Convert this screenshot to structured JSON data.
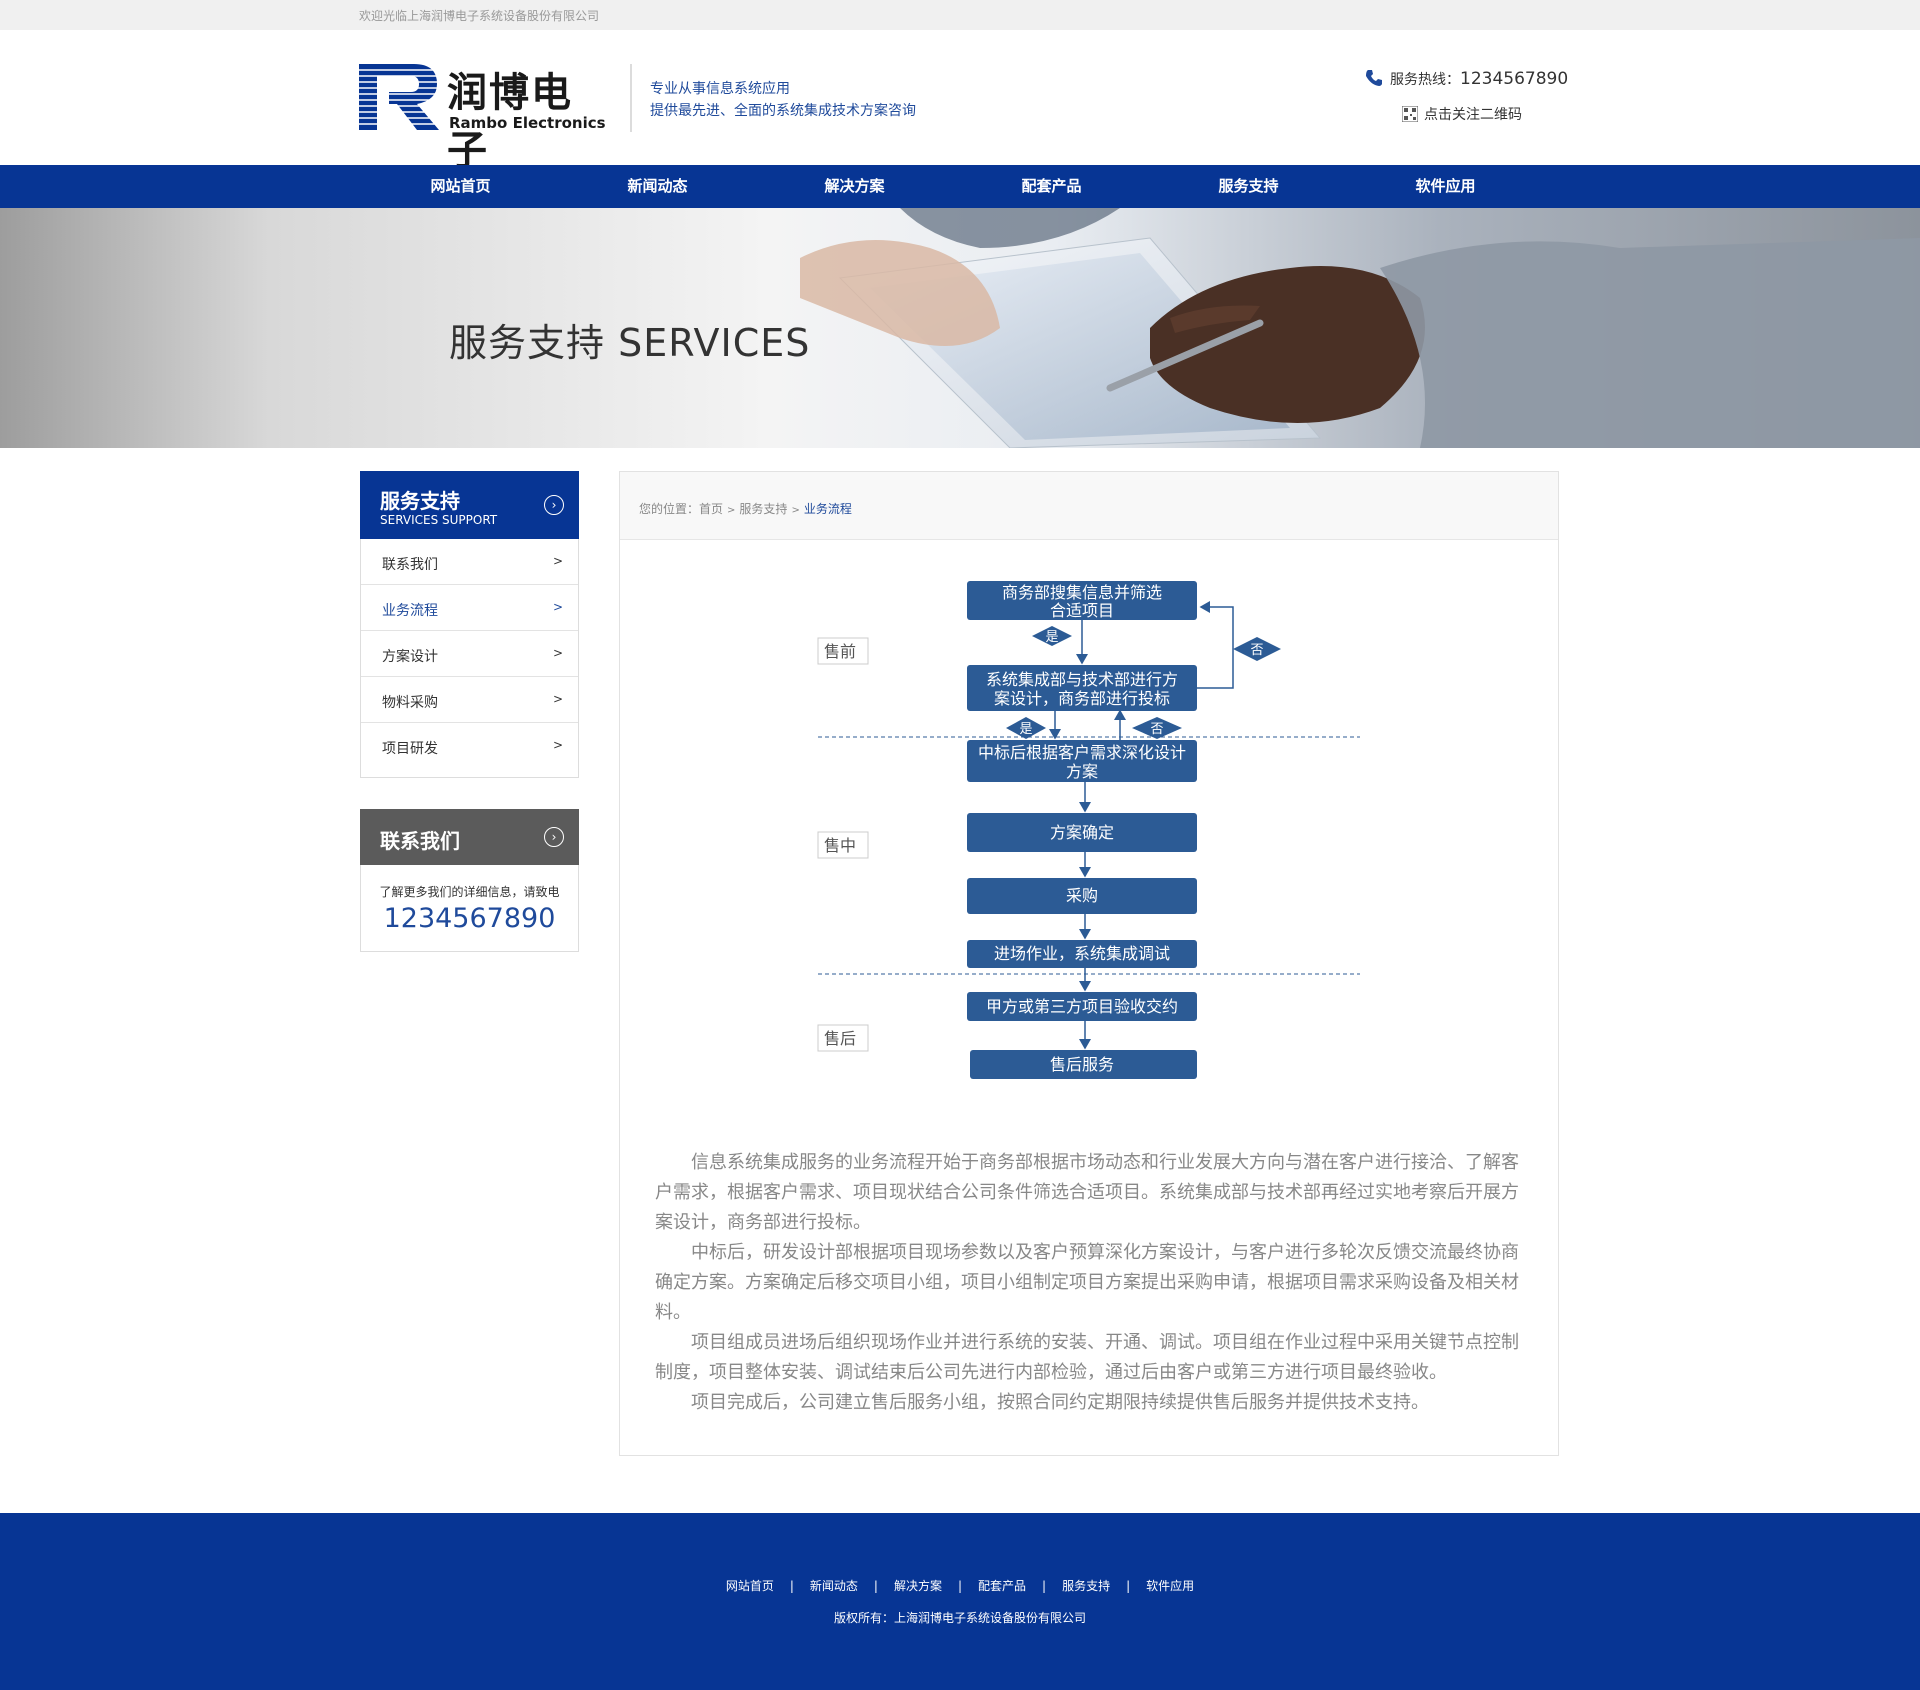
{
  "topbar": {
    "welcome": "欢迎光临上海润博电子系统设备股份有限公司"
  },
  "header": {
    "logo_cn": "润博电子",
    "logo_en": "Rambo Electronics",
    "slogan_line1": "专业从事信息系统应用",
    "slogan_line2": "提供最先进、全面的系统集成技术方案咨询",
    "hotline_label": "服务热线：",
    "hotline_number": "1234567890",
    "qr_label": "点击关注二维码"
  },
  "nav": {
    "items": [
      "网站首页",
      "新闻动态",
      "解决方案",
      "配套产品",
      "服务支持",
      "软件应用"
    ]
  },
  "banner": {
    "title": "服务支持 SERVICES"
  },
  "sidebar": {
    "title": "服务支持",
    "subtitle": "SERVICES SUPPORT",
    "arrow": ">",
    "items": [
      {
        "label": "联系我们"
      },
      {
        "label": "业务流程"
      },
      {
        "label": "方案设计"
      },
      {
        "label": "物料采购"
      },
      {
        "label": "项目研发"
      }
    ],
    "active_index": 1
  },
  "contact": {
    "title": "联系我们",
    "desc": "了解更多我们的详细信息，请致电",
    "phone": "1234567890"
  },
  "breadcrumb": {
    "prefix": "您的位置：",
    "home": "首页",
    "section": "服务支持",
    "current": "业务流程",
    "separator": ">"
  },
  "flowchart": {
    "phases": [
      "售前",
      "售中",
      "售后"
    ],
    "steps": [
      [
        "商务部搜集信息并筛选",
        "合适项目"
      ],
      [
        "系统集成部与技术部进行方",
        "案设计，商务部进行投标"
      ],
      [
        "中标后根据客户需求深化设计",
        "方案"
      ],
      [
        "方案确定"
      ],
      [
        "采购"
      ],
      [
        "进场作业，系统集成调试"
      ],
      [
        "甲方或第三方项目验收交约"
      ],
      [
        "售后服务"
      ]
    ],
    "yes": "是",
    "no": "否"
  },
  "article": {
    "paragraphs": [
      "信息系统集成服务的业务流程开始于商务部根据市场动态和行业发展大方向与潜在客户进行接洽、了解客户需求，根据客户需求、项目现状结合公司条件筛选合适项目。系统集成部与技术部再经过实地考察后开展方案设计，商务部进行投标。",
      "中标后，研发设计部根据项目现场参数以及客户预算深化方案设计，与客户进行多轮次反馈交流最终协商确定方案。方案确定后移交项目小组，项目小组制定项目方案提出采购申请，根据项目需求采购设备及相关材料。",
      "项目组成员进场后组织现场作业并进行系统的安装、开通、调试。项目组在作业过程中采用关键节点控制制度，项目整体安装、调试结束后公司先进行内部检验，通过后由客户或第三方进行项目最终验收。",
      "项目完成后，公司建立售后服务小组，按照合同约定期限持续提供售后服务并提供技术支持。"
    ]
  },
  "footer": {
    "links": [
      "网站首页",
      "新闻动态",
      "解决方案",
      "配套产品",
      "服务支持",
      "软件应用"
    ],
    "separator": "|",
    "copyright": "版权所有：上海润博电子系统设备股份有限公司"
  },
  "colors": {
    "brand_blue": "#073594",
    "flow_box": "#2c5b95",
    "gray_head": "#5b5b5b"
  }
}
